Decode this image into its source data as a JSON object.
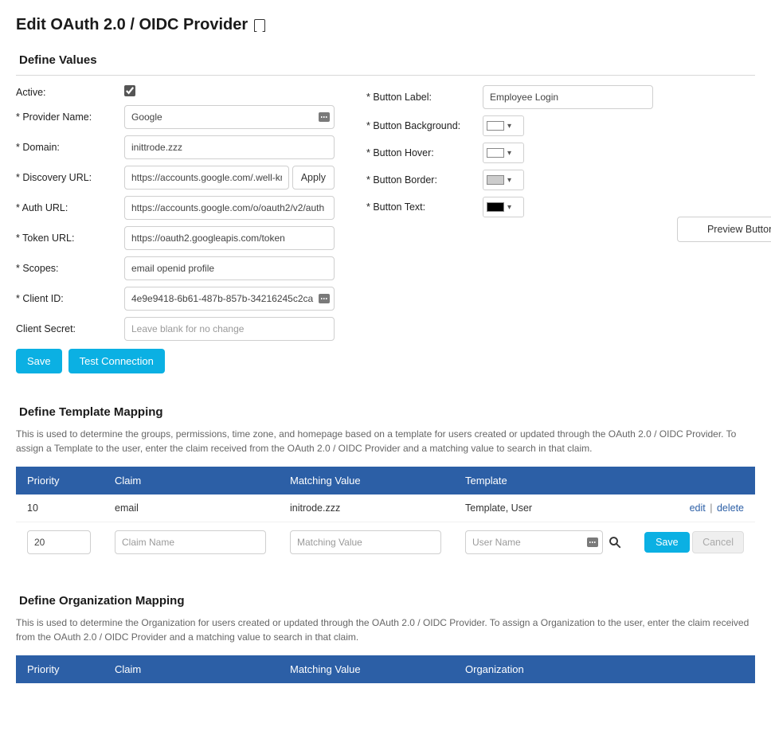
{
  "page": {
    "title": "Edit OAuth 2.0 / OIDC Provider"
  },
  "defineValues": {
    "title": "Define Values",
    "labels": {
      "active": "Active:",
      "providerName": "* Provider Name:",
      "domain": "* Domain:",
      "discoveryUrl": "* Discovery URL:",
      "authUrl": "* Auth URL:",
      "tokenUrl": "* Token URL:",
      "scopes": "* Scopes:",
      "clientId": "* Client ID:",
      "clientSecret": "Client Secret:",
      "buttonLabel": "* Button Label:",
      "buttonBackground": "* Button Background:",
      "buttonHover": "* Button Hover:",
      "buttonBorder": "* Button Border:",
      "buttonText": "* Button Text:"
    },
    "values": {
      "active": true,
      "providerName": "Google",
      "domain": "inittrode.zzz",
      "discoveryUrl": "https://accounts.google.com/.well-kn",
      "authUrl": "https://accounts.google.com/o/oauth2/v2/auth",
      "tokenUrl": "https://oauth2.googleapis.com/token",
      "scopes": "email openid profile",
      "clientId": "4e9e9418-6b61-487b-857b-34216245c2ca",
      "clientSecretPlaceholder": "Leave blank for no change",
      "buttonLabel": "Employee Login",
      "buttonBackground": "#ffffff",
      "buttonHover": "#ffffff",
      "buttonBorder": "#cccccc",
      "buttonText": "#000000"
    },
    "buttons": {
      "apply": "Apply",
      "save": "Save",
      "testConnection": "Test Connection",
      "preview": "Preview Button"
    }
  },
  "templateMapping": {
    "title": "Define Template Mapping",
    "description": "This is used to determine the groups, permissions, time zone, and homepage based on a template for users created or updated through the OAuth 2.0 / OIDC Provider. To assign a Template to the user, enter the claim received from the OAuth 2.0 / OIDC Provider and a matching value to search in that claim.",
    "headers": {
      "priority": "Priority",
      "claim": "Claim",
      "matchingValue": "Matching Value",
      "template": "Template"
    },
    "rows": [
      {
        "priority": "10",
        "claim": "email",
        "matchingValue": "initrode.zzz",
        "template": "Template, User"
      }
    ],
    "newRow": {
      "priority": "20",
      "claimPlaceholder": "Claim Name",
      "matchingPlaceholder": "Matching Value",
      "templatePlaceholder": "User Name"
    },
    "actions": {
      "edit": "edit",
      "delete": "delete",
      "save": "Save",
      "cancel": "Cancel"
    }
  },
  "orgMapping": {
    "title": "Define Organization Mapping",
    "description": "This is used to determine the Organization for users created or updated through the OAuth 2.0 / OIDC Provider. To assign a Organization to the user, enter the claim received from the OAuth 2.0 / OIDC Provider and a matching value to search in that claim.",
    "headers": {
      "priority": "Priority",
      "claim": "Claim",
      "matchingValue": "Matching Value",
      "organization": "Organization"
    }
  }
}
